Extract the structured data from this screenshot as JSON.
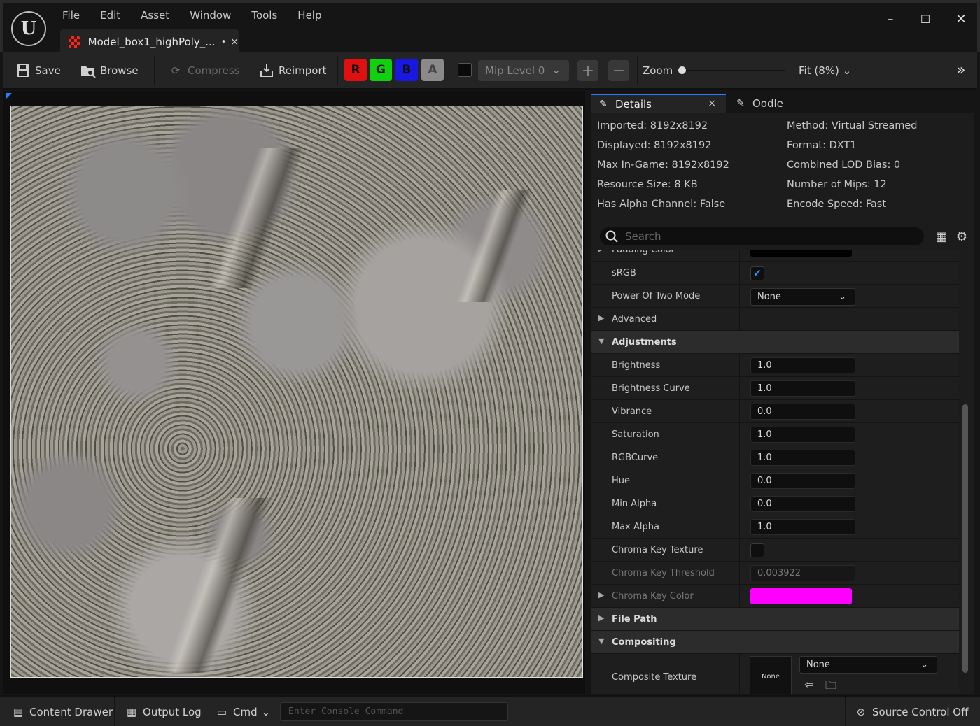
{
  "menu": [
    "File",
    "Edit",
    "Asset",
    "Window",
    "Tools",
    "Help"
  ],
  "tab": {
    "label": "Model_box1_highPoly_...",
    "dirty": "•",
    "close": "×"
  },
  "window_controls": {
    "minimize": "–",
    "maximize": "☐",
    "close": "✕"
  },
  "toolbar": {
    "save": "Save",
    "browse": "Browse",
    "compress": "Compress",
    "reimport": "Reimport",
    "channels": [
      "R",
      "G",
      "B",
      "A"
    ],
    "mip_level": "Mip Level 0",
    "zoom_label": "Zoom",
    "zoom_value": 0.0,
    "fit": "Fit (8%)"
  },
  "details_tabs": {
    "details": "Details",
    "oodle": "Oodle",
    "close": "×"
  },
  "info_left": [
    "Imported: 8192x8192",
    "Displayed: 8192x8192",
    "Max In-Game: 8192x8192",
    "Resource Size: 8 KB",
    "Has Alpha Channel: False"
  ],
  "info_right": [
    "Method: Virtual Streamed",
    "Format: DXT1",
    "Combined LOD Bias: 0",
    "Number of Mips: 12",
    "Encode Speed: Fast"
  ],
  "search_placeholder": "Search",
  "properties": {
    "padding_color": "Padding Color",
    "srgb": "sRGB",
    "power_of_two": {
      "label": "Power Of Two Mode",
      "value": "None"
    },
    "advanced": "Advanced",
    "adjustments": "Adjustments",
    "brightness": {
      "label": "Brightness",
      "value": "1.0"
    },
    "brightness_curve": {
      "label": "Brightness Curve",
      "value": "1.0"
    },
    "vibrance": {
      "label": "Vibrance",
      "value": "0.0"
    },
    "saturation": {
      "label": "Saturation",
      "value": "1.0"
    },
    "rgbcurve": {
      "label": "RGBCurve",
      "value": "1.0"
    },
    "hue": {
      "label": "Hue",
      "value": "0.0"
    },
    "min_alpha": {
      "label": "Min Alpha",
      "value": "0.0"
    },
    "max_alpha": {
      "label": "Max Alpha",
      "value": "1.0"
    },
    "chroma_key_texture": "Chroma Key Texture",
    "chroma_key_threshold": {
      "label": "Chroma Key Threshold",
      "value": "0.003922"
    },
    "chroma_key_color": {
      "label": "Chroma Key Color",
      "color": "#ff00ff"
    },
    "file_path": "File Path",
    "compositing": "Compositing",
    "composite_texture": {
      "label": "Composite Texture",
      "thumb": "None",
      "value": "None"
    }
  },
  "statusbar": {
    "content_drawer": "Content Drawer",
    "output_log": "Output Log",
    "cmd": "Cmd",
    "console_placeholder": "Enter Console Command",
    "source_control": "Source Control Off"
  },
  "colors": {
    "accent": "#2a7fff",
    "red": "#e01010",
    "green": "#10d010",
    "blue": "#1818e0",
    "alpha": "#8a8a8a"
  }
}
